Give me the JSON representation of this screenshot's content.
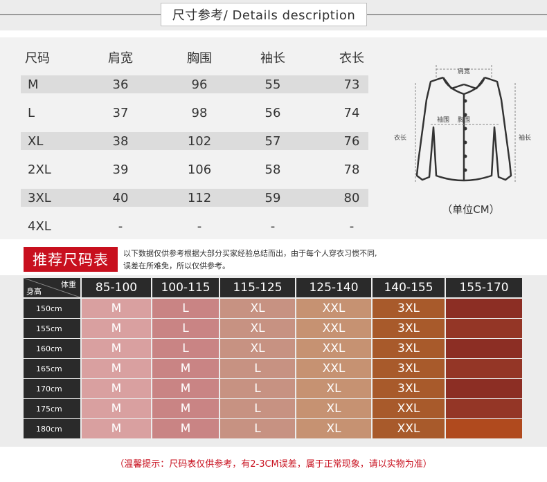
{
  "header": {
    "title": "尺寸参考/ Details description"
  },
  "spec": {
    "columns": [
      "尺码",
      "肩宽",
      "胸围",
      "袖长",
      "衣长"
    ],
    "rows": [
      [
        "M",
        "36",
        "96",
        "55",
        "73"
      ],
      [
        "L",
        "37",
        "98",
        "56",
        "74"
      ],
      [
        "XL",
        "38",
        "102",
        "57",
        "76"
      ],
      [
        "2XL",
        "39",
        "106",
        "58",
        "78"
      ],
      [
        "3XL",
        "40",
        "112",
        "59",
        "80"
      ],
      [
        "4XL",
        "-",
        "-",
        "-",
        "-"
      ]
    ]
  },
  "diagram": {
    "shoulder_label": "肩宽",
    "length_label": "衣长",
    "sleeve_label": "袖长",
    "chest_label": "胸围",
    "cuff_label": "袖围",
    "unit": "（单位CM）"
  },
  "recommend": {
    "title": "推荐尺码表",
    "note_line1": "以下数据仅供参考根据大部分买家经验总结而出，由于每个人穿衣习惯不同,",
    "note_line2": "误差在所难免，所以仅供参考。",
    "corner_weight": "体重",
    "corner_height": "身高",
    "weight_ranges": [
      "85-100",
      "100-115",
      "115-125",
      "125-140",
      "140-155",
      "155-170"
    ],
    "heights": [
      "150cm",
      "155cm",
      "160cm",
      "165cm",
      "170cm",
      "175cm",
      "180cm"
    ],
    "grid": [
      [
        "M",
        "L",
        "XL",
        "XXL",
        "3XL",
        ""
      ],
      [
        "M",
        "L",
        "XL",
        "XXL",
        "3XL",
        ""
      ],
      [
        "M",
        "L",
        "XL",
        "XXL",
        "3XL",
        ""
      ],
      [
        "M",
        "M",
        "L",
        "XXL",
        "3XL",
        ""
      ],
      [
        "M",
        "M",
        "L",
        "XL",
        "3XL",
        ""
      ],
      [
        "M",
        "M",
        "L",
        "XL",
        "XXL",
        ""
      ],
      [
        "M",
        "M",
        "L",
        "XL",
        "XXL",
        ""
      ]
    ],
    "column_colors": [
      "#d9a0a0",
      "#c98484",
      "#c79282",
      "#c69272",
      "#a85a2b",
      "#8c2e24"
    ],
    "alt_column_colors": [
      "#d9a0a0",
      "#c98484",
      "#c79282",
      "#c69272",
      "#a85a2b",
      "#8c2e24"
    ]
  },
  "footer": {
    "tip": "（温馨提示：尺码表仅供参考，有2-3CM误差，属于正常现象，请以实物为准）"
  }
}
